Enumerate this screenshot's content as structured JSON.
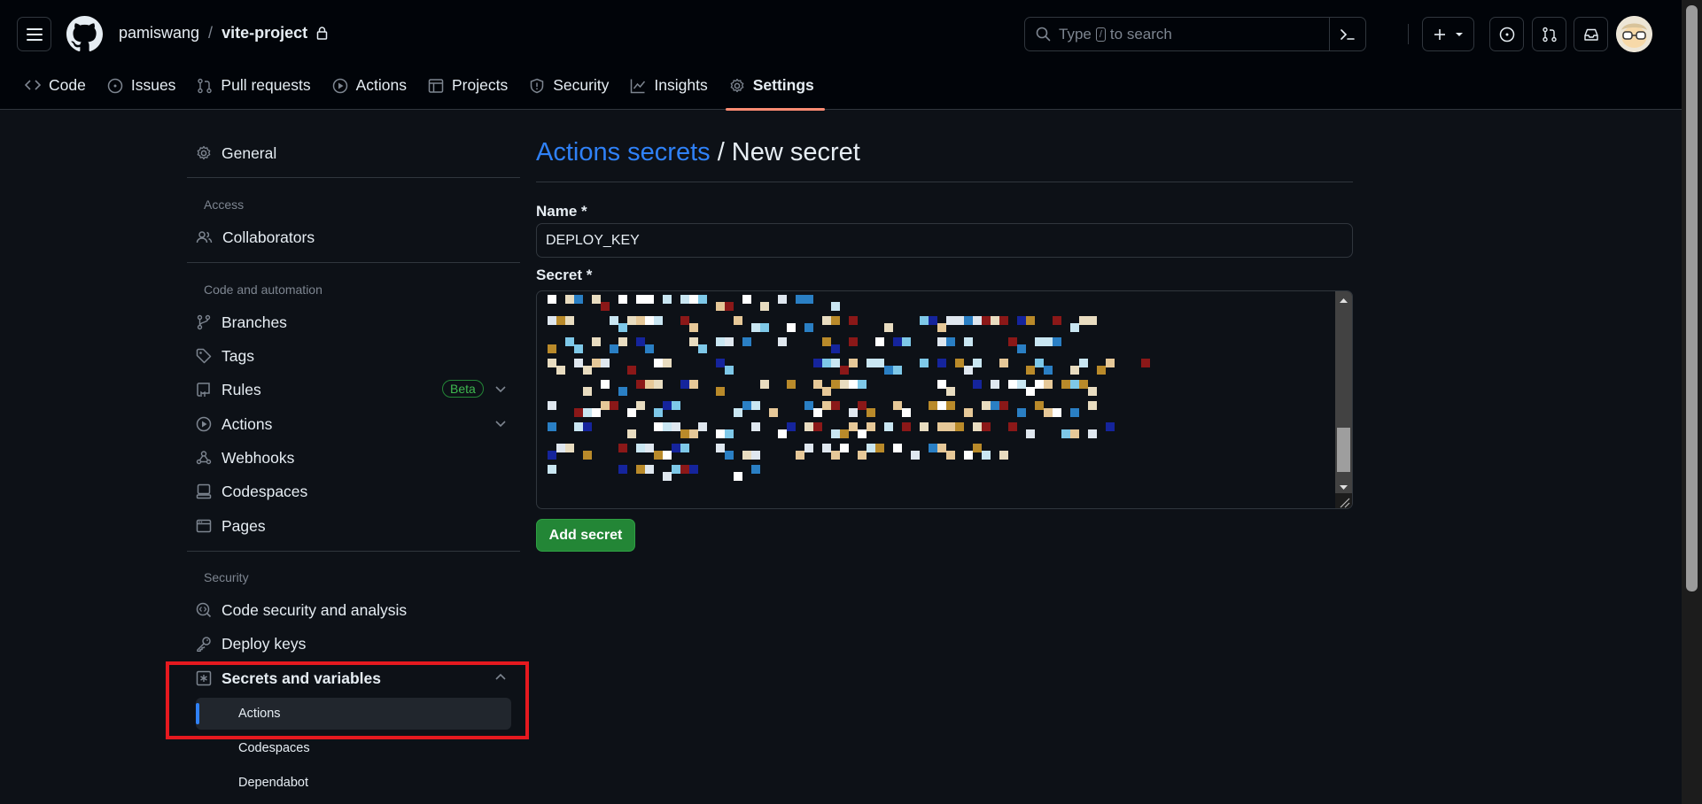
{
  "header": {
    "owner": "pamiswang",
    "separator": "/",
    "repo": "vite-project",
    "search_prefix": "Type",
    "search_key": "/",
    "search_suffix": "to search"
  },
  "repo_nav": {
    "tabs": [
      {
        "label": "Code",
        "icon": "code-icon"
      },
      {
        "label": "Issues",
        "icon": "issue-icon"
      },
      {
        "label": "Pull requests",
        "icon": "pull-request-icon"
      },
      {
        "label": "Actions",
        "icon": "play-icon"
      },
      {
        "label": "Projects",
        "icon": "table-icon"
      },
      {
        "label": "Security",
        "icon": "shield-icon"
      },
      {
        "label": "Insights",
        "icon": "graph-icon"
      },
      {
        "label": "Settings",
        "icon": "gear-icon",
        "active": true
      }
    ]
  },
  "sidebar": {
    "general": "General",
    "access_heading": "Access",
    "collaborators": "Collaborators",
    "code_automation_heading": "Code and automation",
    "branches": "Branches",
    "tags": "Tags",
    "rules": "Rules",
    "beta": "Beta",
    "actions": "Actions",
    "webhooks": "Webhooks",
    "codespaces": "Codespaces",
    "pages": "Pages",
    "security_heading": "Security",
    "code_security": "Code security and analysis",
    "deploy_keys": "Deploy keys",
    "secrets_variables": "Secrets and variables",
    "sub_actions": "Actions",
    "sub_codespaces": "Codespaces",
    "sub_dependabot": "Dependabot"
  },
  "main": {
    "title_link": "Actions secrets",
    "title_rest": " / New secret",
    "name_label": "Name *",
    "name_value": "DEPLOY_KEY",
    "secret_label": "Secret *",
    "secret_state": "redacted (pixelated)",
    "add_button": "Add secret"
  },
  "colors": {
    "accent_blue": "#2f81f7",
    "button_green": "#238636",
    "highlight_red": "#e5191f",
    "tab_underline": "#fd8c73"
  }
}
